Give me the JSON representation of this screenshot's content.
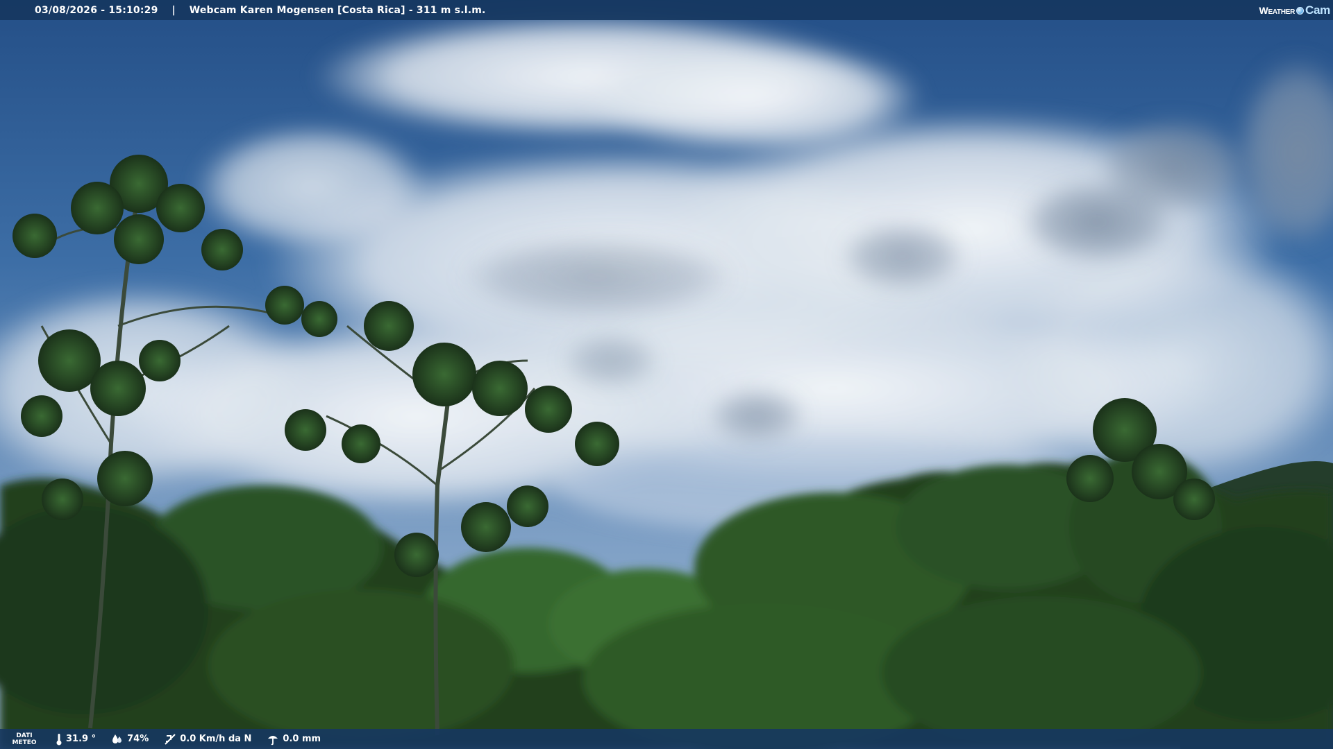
{
  "header": {
    "datetime": "03/08/2026 - 15:10:29",
    "separator": "|",
    "location": "Webcam Karen Mogensen [Costa Rica] - 311 m s.l.m."
  },
  "logo": {
    "weather_text": "Weather",
    "cam_text": "Cam",
    "icon": "sun-dot-icon"
  },
  "footer": {
    "label_line1": "DATI",
    "label_line2": "METEO",
    "temperature": "31.9 °",
    "humidity": "74%",
    "wind": "0.0 Km/h da N",
    "rain": "0.0 mm",
    "icons": [
      "thermometer-icon",
      "humidity-drop-icon",
      "wind-icon",
      "rain-icon"
    ]
  },
  "colors": {
    "bar_background": "#163760",
    "sky_top": "#2a5a94",
    "cloud": "#dfe6ee",
    "foliage_dark": "#1f3a1e",
    "foliage_mid": "#2f5a2a"
  }
}
